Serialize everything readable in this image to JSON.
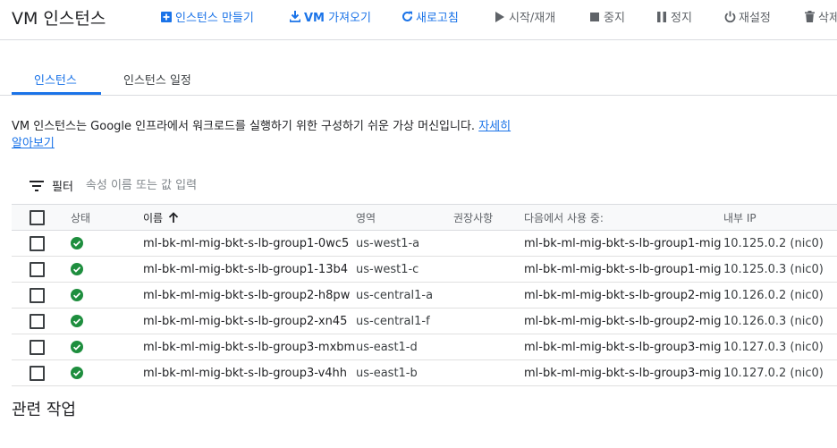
{
  "header": {
    "title": "VM 인스턴스",
    "actions": {
      "create": "인스턴스 만들기",
      "import_prefix": "VM",
      "import_suffix": " 가져오기",
      "refresh": "새로고침",
      "start": "시작/재개",
      "stop": "중지",
      "pause": "정지",
      "reset": "재설정",
      "delete": "삭제"
    }
  },
  "tabs": [
    "인스턴스",
    "인스턴스 일정"
  ],
  "description": {
    "text": "VM 인스턴스는 Google 인프라에서 워크로드를 실행하기 위한 구성하기 쉬운 가상 머신입니다.",
    "link": "자세히 알아보기"
  },
  "filter": {
    "label": "필터",
    "placeholder": "속성 이름 또는 값 입력"
  },
  "table": {
    "columns": {
      "status": "상태",
      "name": "이름",
      "zone": "영역",
      "recommendation": "권장사항",
      "in_use_by": "다음에서 사용 중:",
      "internal_ip": "내부 IP"
    },
    "rows": [
      {
        "name": "ml-bk-ml-mig-bkt-s-lb-group1-0wc5",
        "zone": "us-west1-a",
        "in_use_by": "ml-bk-ml-mig-bkt-s-lb-group1-mig",
        "ip": "10.125.0.2 (nic0)"
      },
      {
        "name": "ml-bk-ml-mig-bkt-s-lb-group1-13b4",
        "zone": "us-west1-c",
        "in_use_by": "ml-bk-ml-mig-bkt-s-lb-group1-mig",
        "ip": "10.125.0.3 (nic0)"
      },
      {
        "name": "ml-bk-ml-mig-bkt-s-lb-group2-h8pw",
        "zone": "us-central1-a",
        "in_use_by": "ml-bk-ml-mig-bkt-s-lb-group2-mig",
        "ip": "10.126.0.2 (nic0)"
      },
      {
        "name": "ml-bk-ml-mig-bkt-s-lb-group2-xn45",
        "zone": "us-central1-f",
        "in_use_by": "ml-bk-ml-mig-bkt-s-lb-group2-mig",
        "ip": "10.126.0.3 (nic0)"
      },
      {
        "name": "ml-bk-ml-mig-bkt-s-lb-group3-mxbm",
        "zone": "us-east1-d",
        "in_use_by": "ml-bk-ml-mig-bkt-s-lb-group3-mig",
        "ip": "10.127.0.3 (nic0)"
      },
      {
        "name": "ml-bk-ml-mig-bkt-s-lb-group3-v4hh",
        "zone": "us-east1-b",
        "in_use_by": "ml-bk-ml-mig-bkt-s-lb-group3-mig",
        "ip": "10.127.0.2 (nic0)"
      }
    ]
  },
  "related": "관련 작업",
  "colors": {
    "accent": "#1a73e8",
    "status_ok": "#1e8e3e",
    "icon_gray": "#5f6368"
  }
}
